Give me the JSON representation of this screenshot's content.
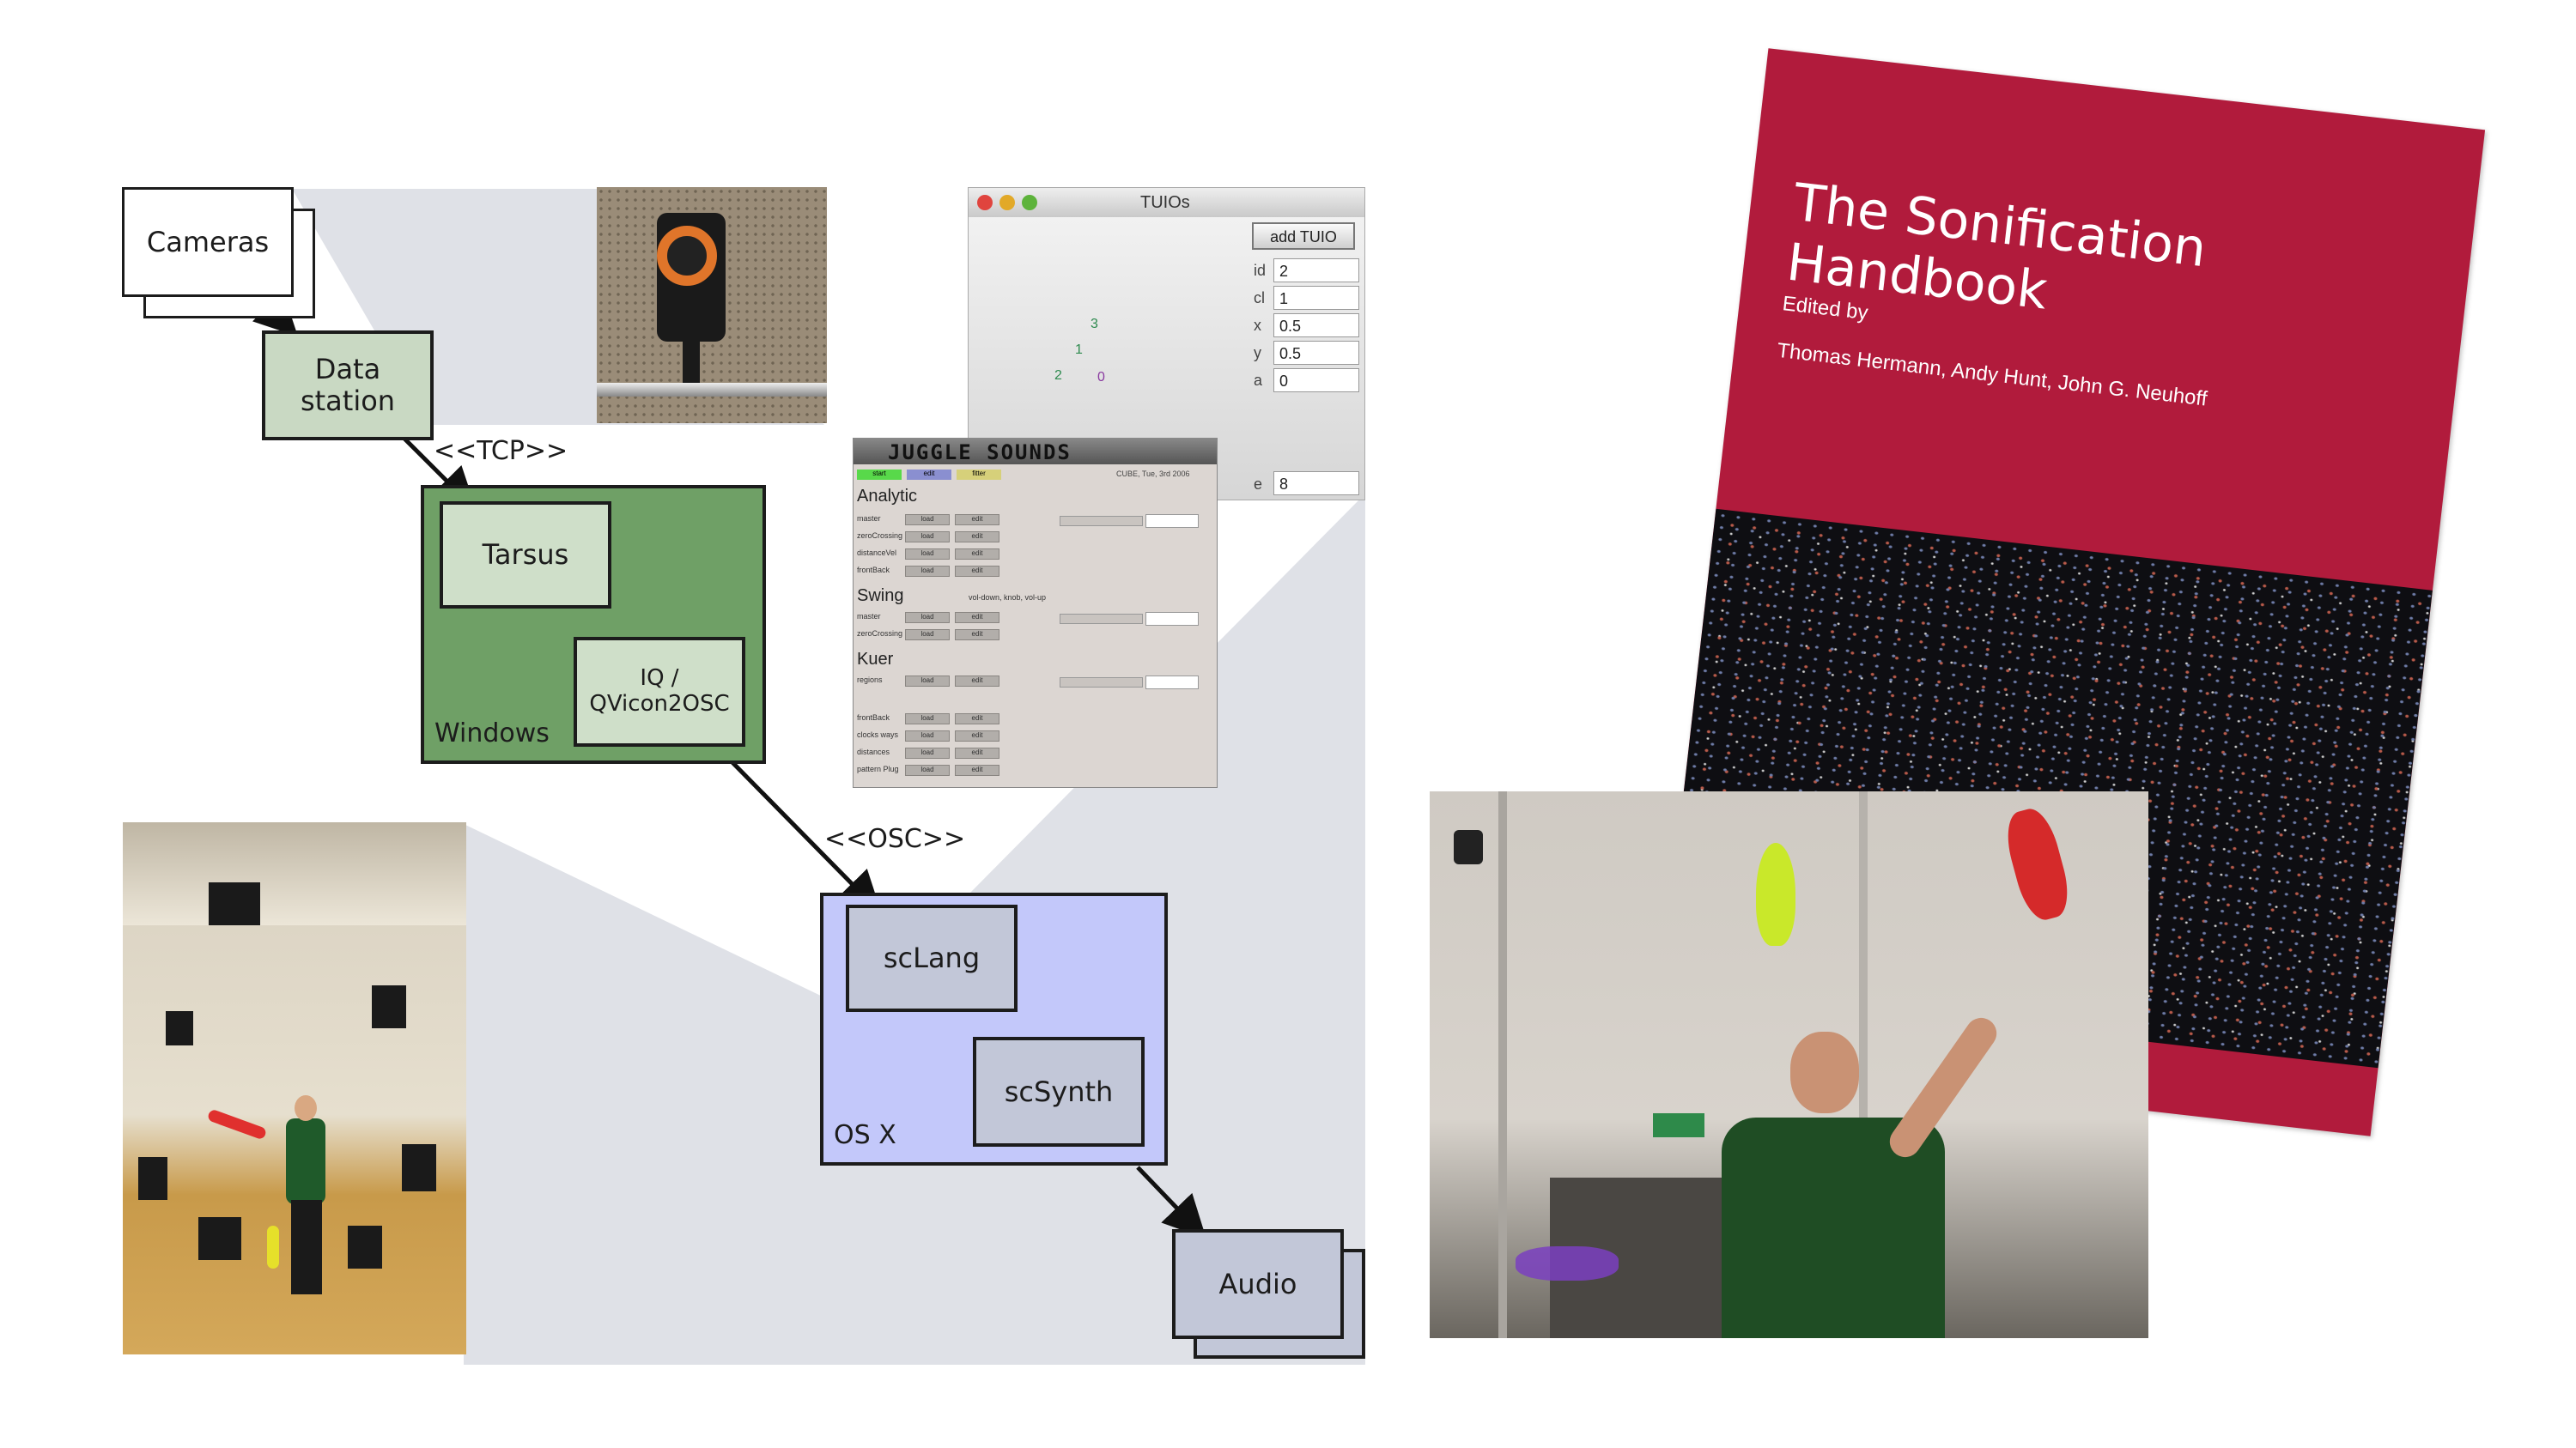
{
  "diagram": {
    "nodes": {
      "cameras": "Cameras",
      "data_station": "Data\nstation",
      "tarsus": "Tarsus",
      "iq": "IQ /\nQVicon2OSC",
      "windows": "Windows",
      "sclang": "scLang",
      "scsynth": "scSynth",
      "osx": "OS X",
      "audio": "Audio"
    },
    "edges": {
      "tcp": "<<TCP>>",
      "osc": "<<OSC>>"
    }
  },
  "tuio_window": {
    "title": "TUIOs",
    "add_button": "add TUIO",
    "fields": [
      {
        "label": "id",
        "value": "2"
      },
      {
        "label": "cl",
        "value": "1"
      },
      {
        "label": "x",
        "value": "0.5"
      },
      {
        "label": "y",
        "value": "0.5"
      },
      {
        "label": "a",
        "value": "0"
      },
      {
        "label": "e",
        "value": "8"
      }
    ],
    "markers": [
      "3",
      "1",
      "2",
      "0"
    ]
  },
  "juggle_window": {
    "title": "JUGGLE SOUNDS",
    "date": "CUBE, Tue, 3rd 2006",
    "tabs": [
      "start",
      "edit",
      "fitter"
    ],
    "sections": [
      {
        "name": "Analytic",
        "rows": [
          "master",
          "zeroCrossing",
          "distanceVel",
          "frontBack"
        ]
      },
      {
        "name": "Swing",
        "note": "vol-down, knob, vol-up",
        "rows": [
          "master",
          "zeroCrossing"
        ]
      },
      {
        "name": "Kuer",
        "rows": [
          "regions"
        ]
      },
      {
        "name": "",
        "rows": [
          "frontBack",
          "clocks ways",
          "distances",
          "pattern Plug"
        ]
      }
    ],
    "button_labels": [
      "load",
      "edit"
    ]
  },
  "book": {
    "title": "The Sonification Handbook",
    "edited_by": "Edited by",
    "authors": "Thomas Hermann, Andy Hunt, John G. Neuhoff",
    "colors": {
      "cover": "#b11b3c",
      "dark": "#0e0e12"
    }
  },
  "colors": {
    "cameras": "#ffffff",
    "data_station": "#c9d9c3",
    "windows": "#6fa066",
    "tarsus": "#cfdfc9",
    "osx": "#c3c8fa",
    "sclang": "#c2c7d8",
    "audio": "#c2c7d8",
    "projection": "#dfe1e7"
  }
}
